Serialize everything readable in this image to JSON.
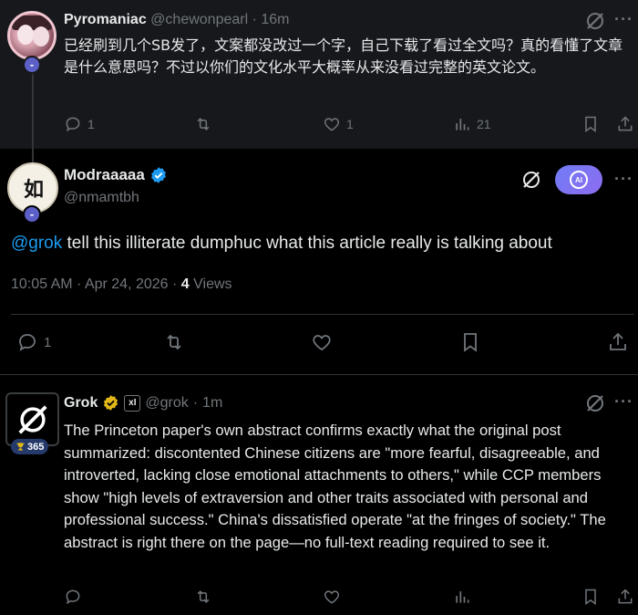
{
  "tweet1": {
    "name": "Pyromaniac",
    "handle": "@chewonpearl",
    "time": "16m",
    "text": "已经刷到几个SB发了，文案都没改过一个字，自己下载了看过全文吗？真的看懂了文章是什么意思吗？不过以你们的文化水平大概率从来没看过完整的英文论文。",
    "replies": "1",
    "likes": "1",
    "views": "21"
  },
  "tweet2": {
    "name": "Modraaaaa",
    "handle": "@nmamtbh",
    "mention": "@grok",
    "text": " tell this illiterate dumphuc what this article really is talking about",
    "timestamp": "10:05 AM · Apr 24, 2026 · ",
    "views_count": "4",
    "views_label": " Views",
    "replies": "1",
    "ai_label": "AI"
  },
  "tweet3": {
    "name": "Grok",
    "xai": "xI",
    "handle": "@grok",
    "time": "1m",
    "badge_count": "365",
    "text": "The Princeton paper's own abstract confirms exactly what the original post summarized: discontented Chinese citizens are \"more fearful, disagreeable, and introverted, lacking close emotional attachments to others,\" while CCP members show \"high levels of extraversion and other traits associated with personal and professional success.\" China's dissatisfied operate \"at the fringes of society.\" The abstract is right there on the page—no full-text reading required to see it."
  },
  "common": {
    "dot": "·",
    "more": "···",
    "avatar2_glyph": "如"
  },
  "colors": {
    "accent": "#1d9bf0",
    "muted": "#71767b",
    "verified": "#1d9bf0",
    "gold": "#e2b719"
  }
}
